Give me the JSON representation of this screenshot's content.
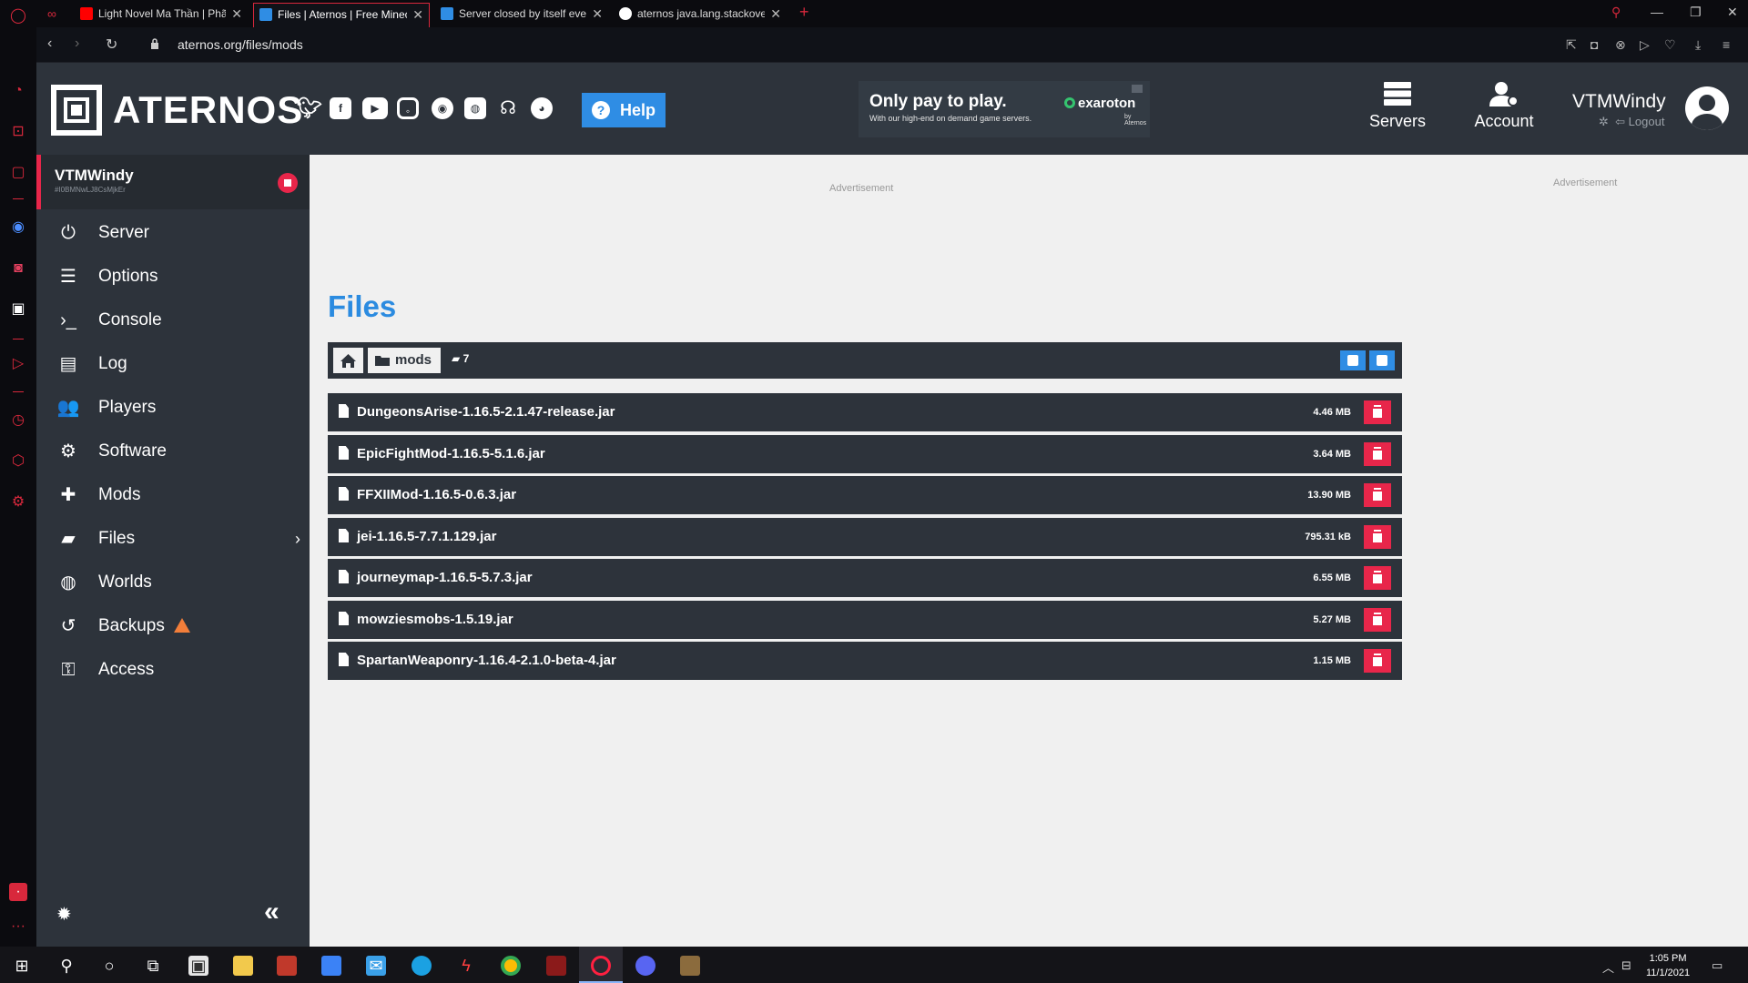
{
  "browser": {
    "tabs": [
      {
        "title": "Light Novel Ma Thần | Phã",
        "favicon_color": "#ff0000"
      },
      {
        "title": "Files | Aternos | Free Minec",
        "favicon_color": "#2f8de4"
      },
      {
        "title": "Server closed by itself even",
        "favicon_color": "#2f8de4"
      },
      {
        "title": "aternos java.lang.stackover",
        "favicon_color": "#ffffff"
      }
    ],
    "url": "aternos.org/files/mods",
    "new_tab": "+"
  },
  "header": {
    "logo_text": "ATERNOS",
    "social": [
      "twitter-icon",
      "facebook-icon",
      "youtube-icon",
      "instagram-icon",
      "reddit-icon",
      "discord-icon",
      "support-icon",
      "github-icon"
    ],
    "help_label": "Help",
    "promo": {
      "headline": "Only pay to play.",
      "subline": "With our high-end on demand game servers.",
      "brand": "exaroton",
      "brand_by": "by Aternos"
    },
    "nav": [
      {
        "label": "Servers",
        "icon": "servers-icon"
      },
      {
        "label": "Account",
        "icon": "account-icon"
      }
    ],
    "user": {
      "name": "VTMWindy",
      "logout": "Logout"
    }
  },
  "panel": {
    "server_name": "VTMWindy",
    "server_id": "#I0BMNwLJ8CsMjkEr",
    "status_color": "#e8264a",
    "menu": [
      {
        "label": "Server",
        "icon": "power-icon",
        "glyph": "⏻"
      },
      {
        "label": "Options",
        "icon": "sliders-icon",
        "glyph": "☰"
      },
      {
        "label": "Console",
        "icon": "terminal-icon",
        "glyph": "›_"
      },
      {
        "label": "Log",
        "icon": "log-file-icon",
        "glyph": "▤"
      },
      {
        "label": "Players",
        "icon": "players-icon",
        "glyph": "👥"
      },
      {
        "label": "Software",
        "icon": "gears-icon",
        "glyph": "⚙"
      },
      {
        "label": "Mods",
        "icon": "puzzle-icon",
        "glyph": "✚"
      },
      {
        "label": "Files",
        "icon": "folder-icon",
        "glyph": "▰"
      },
      {
        "label": "Worlds",
        "icon": "globe-icon",
        "glyph": "◍"
      },
      {
        "label": "Backups",
        "icon": "history-icon",
        "glyph": "↺"
      },
      {
        "label": "Access",
        "icon": "user-lock-icon",
        "glyph": "⚿"
      }
    ]
  },
  "main": {
    "ad_label": "Advertisement",
    "title": "Files",
    "breadcrumb": {
      "folder": "mods",
      "count": "7"
    },
    "files": [
      {
        "name": "DungeonsArise-1.16.5-2.1.47-release.jar",
        "size": "4.46 MB"
      },
      {
        "name": "EpicFightMod-1.16.5-5.1.6.jar",
        "size": "3.64 MB"
      },
      {
        "name": "FFXIIMod-1.16.5-0.6.3.jar",
        "size": "13.90 MB"
      },
      {
        "name": "jei-1.16.5-7.7.1.129.jar",
        "size": "795.31 kB"
      },
      {
        "name": "journeymap-1.16.5-5.7.3.jar",
        "size": "6.55 MB"
      },
      {
        "name": "mowziesmobs-1.5.19.jar",
        "size": "5.27 MB"
      },
      {
        "name": "SpartanWeaponry-1.16.4-2.1.0-beta-4.jar",
        "size": "1.15 MB"
      }
    ]
  },
  "taskbar": {
    "time": "1:05 PM",
    "date": "11/1/2021"
  }
}
